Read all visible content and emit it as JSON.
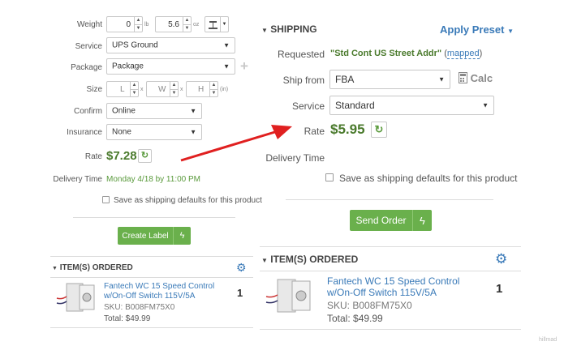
{
  "left": {
    "weight": {
      "label": "Weight",
      "lb_value": "0",
      "lb_unit": "lb",
      "oz_value": "5.6",
      "oz_unit": "oz"
    },
    "service": {
      "label": "Service",
      "value": "UPS Ground"
    },
    "package": {
      "label": "Package",
      "value": "Package"
    },
    "size": {
      "label": "Size",
      "l": "L",
      "w": "W",
      "h": "H",
      "unit": "(in)",
      "sep": "x"
    },
    "confirm": {
      "label": "Confirm",
      "value": "Online"
    },
    "insurance": {
      "label": "Insurance",
      "value": "None"
    },
    "rate": {
      "label": "Rate",
      "value": "$7.28"
    },
    "delivery": {
      "label": "Delivery Time",
      "value": "Monday 4/18 by 11:00 PM"
    },
    "save_defaults": "Save as shipping defaults for this product",
    "create_label": "Create Label",
    "items_header": "ITEM(S) ORDERED",
    "item": {
      "name_line1": "Fantech WC 15 Speed Control",
      "name_line2": "w/On-Off Switch 115V/5A",
      "sku": "SKU: B008FM75X0",
      "total": "Total: $49.99",
      "qty": "1"
    }
  },
  "right": {
    "shipping_header": "SHIPPING",
    "apply_preset": "Apply Preset",
    "requested": {
      "label": "Requested",
      "value": "\"Std Cont US Street Addr\"",
      "mapped_open": "(",
      "mapped": "mapped",
      "mapped_close": ")"
    },
    "ship_from": {
      "label": "Ship from",
      "value": "FBA",
      "calc": "Calc"
    },
    "service": {
      "label": "Service",
      "value": "Standard"
    },
    "rate": {
      "label": "Rate",
      "value": "$5.95"
    },
    "delivery": {
      "label": "Delivery Time"
    },
    "save_defaults": "Save as shipping defaults for this product",
    "send_order": "Send Order",
    "items_header": "ITEM(S) ORDERED",
    "item": {
      "name_line1": "Fantech WC 15 Speed Control",
      "name_line2": "w/On-Off Switch 115V/5A",
      "sku": "SKU: B008FM75X0",
      "total": "Total: $49.99",
      "qty": "1"
    }
  },
  "watermark": "hillmad",
  "colors": {
    "accent_green": "#6ab04c",
    "link_blue": "#3a7ab8",
    "arrow_red": "#e02020",
    "rate_green": "#4a7a2c"
  }
}
